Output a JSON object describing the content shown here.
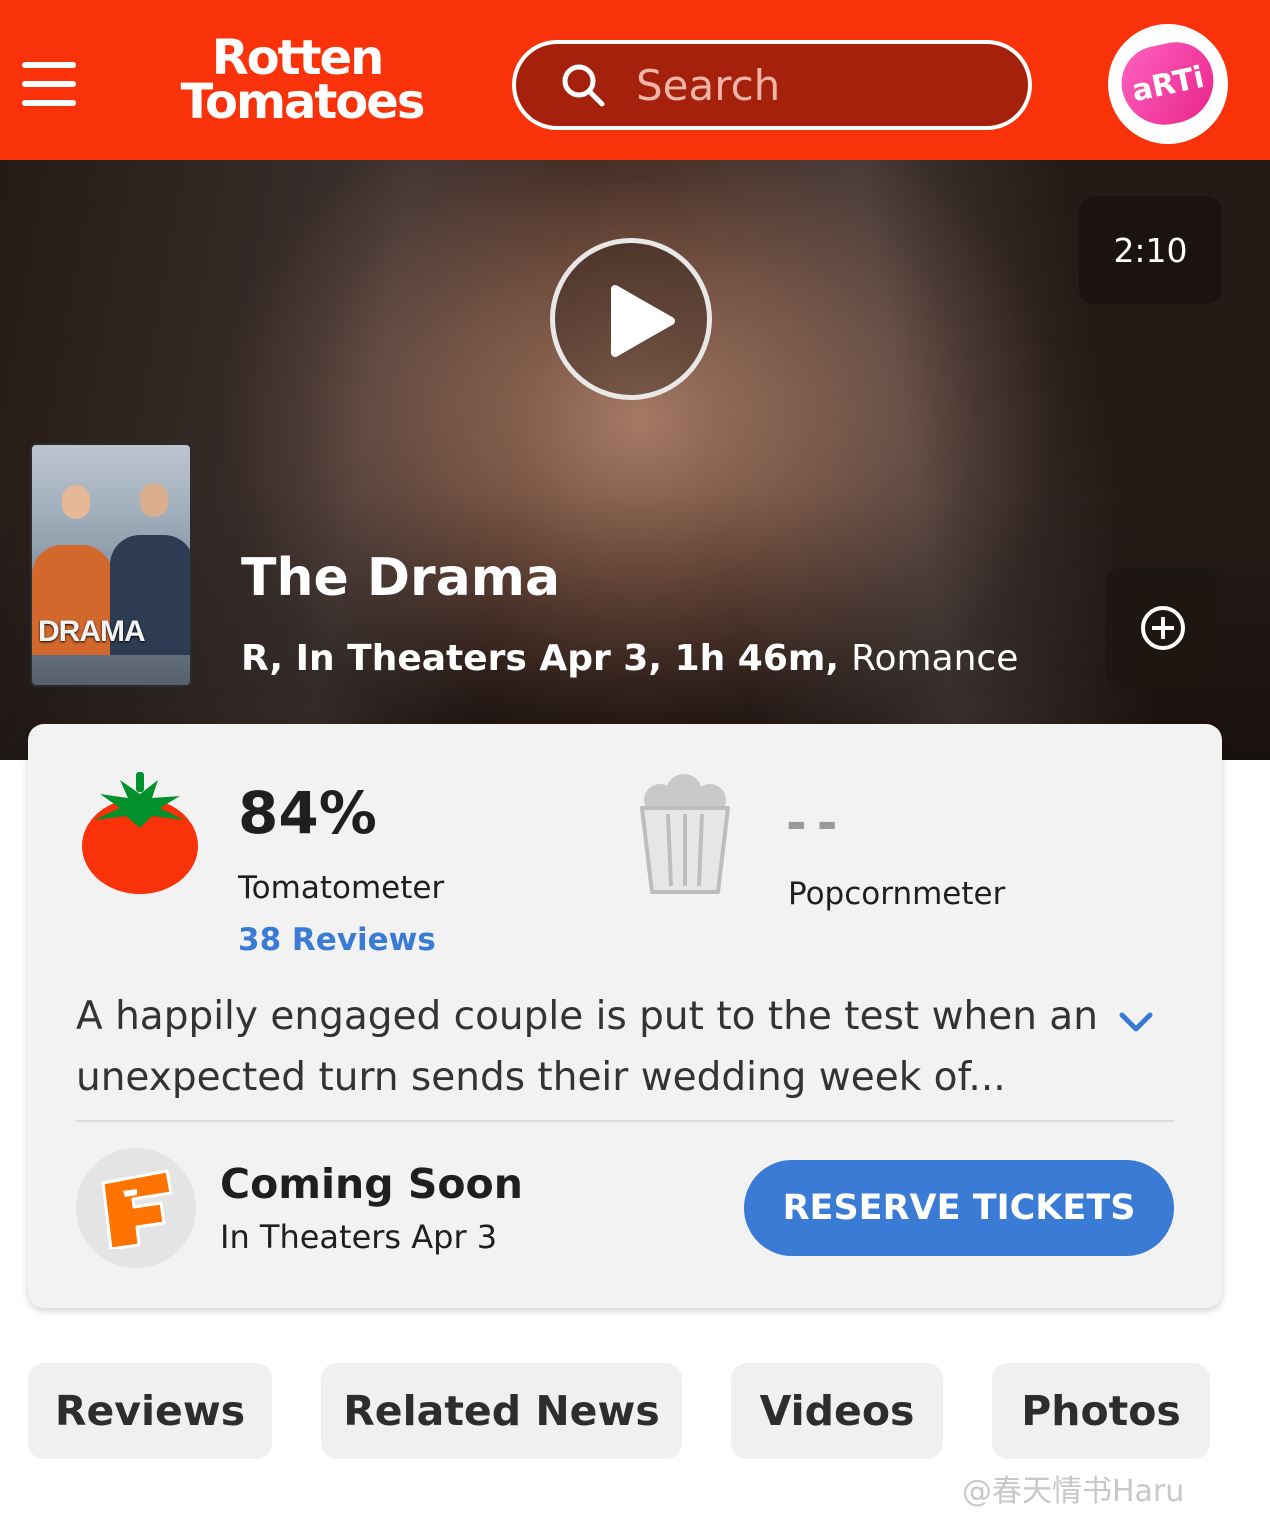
{
  "header": {
    "logo_line1": "Rotten",
    "logo_line2": "Tomatoes",
    "search_placeholder": "Search",
    "avatar_text": "aRTi",
    "brand_color": "#fa320a"
  },
  "hero": {
    "duration": "2:10",
    "poster_title": "DRAMA",
    "title": "The Drama",
    "meta_bold": "R, In Theaters Apr 3, 1h 46m,",
    "genre": "Romance"
  },
  "scores": {
    "tomatometer_value": "84%",
    "tomatometer_label": "Tomatometer",
    "reviews_link": "38 Reviews",
    "popcornmeter_value": "--",
    "popcornmeter_label": "Popcornmeter"
  },
  "synopsis": "A happily engaged couple is put to the test when an unexpected turn sends their wedding week of...",
  "tickets": {
    "status": "Coming Soon",
    "date": "In Theaters Apr 3",
    "button_label": "RESERVE TICKETS",
    "accent_color": "#3a7bd5"
  },
  "tabs": [
    {
      "label": "Reviews"
    },
    {
      "label": "Related News"
    },
    {
      "label": "Videos"
    },
    {
      "label": "Photos"
    }
  ],
  "watermark": "@春天情书Haru"
}
